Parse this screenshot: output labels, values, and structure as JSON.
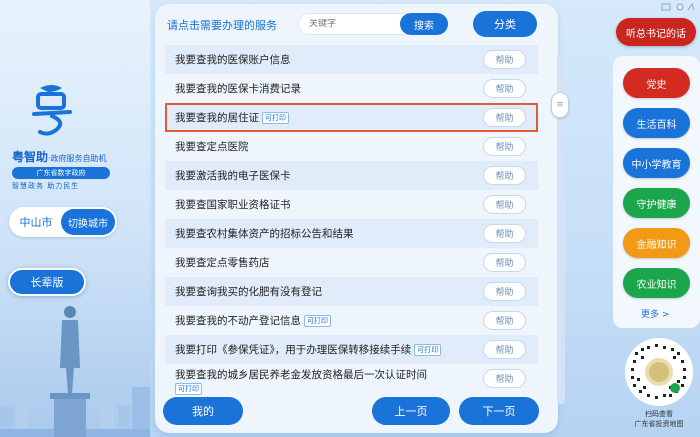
{
  "brand": {
    "title": "粤智助",
    "subtitle": "·政府服务自助机",
    "pill": "广东省数字政府",
    "slogan": "智慧政务 助力民生"
  },
  "city": {
    "name": "中山市",
    "switch_label": "切换城市"
  },
  "elder_mode_label": "长辈版",
  "main": {
    "prompt": "请点击需要办理的服务",
    "search_placeholder": "关键字",
    "search_label": "搜索",
    "category_label": "分类",
    "help_label": "帮助",
    "printable_tag": "可打印",
    "items": [
      {
        "text": "我要查我的医保账户信息",
        "tag": ""
      },
      {
        "text": "我要查我的医保卡消费记录",
        "tag": ""
      },
      {
        "text": "我要查我的居住证",
        "tag": "可打印"
      },
      {
        "text": "我要查定点医院",
        "tag": ""
      },
      {
        "text": "我要激活我的电子医保卡",
        "tag": ""
      },
      {
        "text": "我要查国家职业资格证书",
        "tag": ""
      },
      {
        "text": "我要查农村集体资产的招标公告和结果",
        "tag": ""
      },
      {
        "text": "我要查定点零售药店",
        "tag": ""
      },
      {
        "text": "我要查询我买的化肥有没有登记",
        "tag": ""
      },
      {
        "text": "我要查我的不动产登记信息",
        "tag": "可打印"
      },
      {
        "text": "我要打印《参保凭证》，用于办理医保转移接续手续",
        "tag": "可打印"
      },
      {
        "text": "我要查我的城乡居民养老金发放资格最后一次认证时间",
        "tag": "可打印"
      }
    ],
    "my_label": "我的",
    "prev_label": "上一页",
    "next_label": "下一页"
  },
  "right": {
    "listen_label": "听总书记的话",
    "categories": [
      {
        "label": "党史",
        "color": "#d32a22"
      },
      {
        "label": "生活百科",
        "color": "#1a73d8"
      },
      {
        "label": "中小学教育",
        "color": "#1a73d8"
      },
      {
        "label": "守护健康",
        "color": "#1ba64e"
      },
      {
        "label": "金融知识",
        "color": "#f19a16"
      },
      {
        "label": "农业知识",
        "color": "#1ba64e"
      }
    ],
    "more_label": "更多 >",
    "qr_caption_line1": "扫码查看",
    "qr_caption_line2": "广东省投资地图"
  },
  "colors": {
    "primary": "#1a73d8",
    "selected_outline": "#e05b3c"
  }
}
